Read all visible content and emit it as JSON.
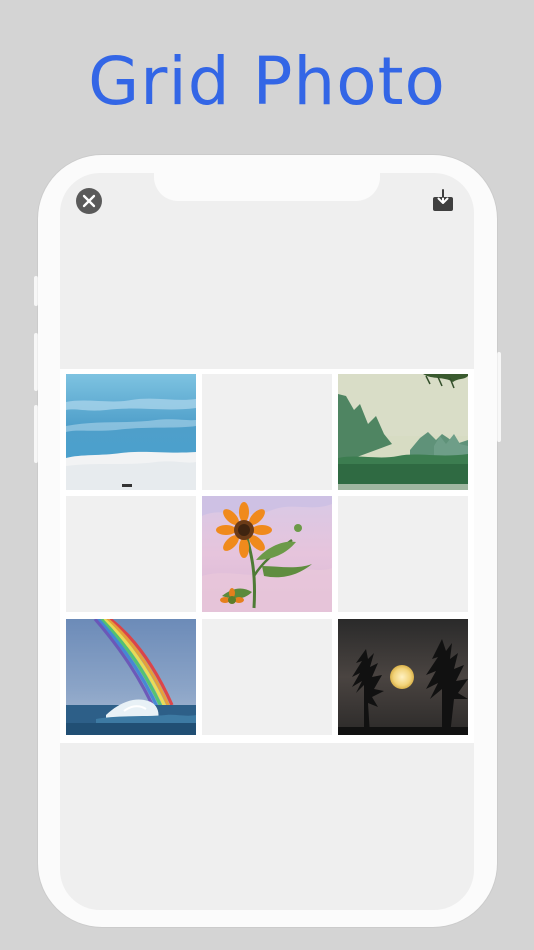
{
  "headline": "Grid Photo",
  "toolbar": {
    "close_icon": "close-icon",
    "download_icon": "download-icon"
  },
  "grid": {
    "columns": 3,
    "rows": 3,
    "tiles": [
      {
        "content": "sky-sea-clouds-photo"
      },
      {
        "content": "empty"
      },
      {
        "content": "green-mountains-river-photo"
      },
      {
        "content": "empty"
      },
      {
        "content": "sunflower-photo"
      },
      {
        "content": "empty"
      },
      {
        "content": "rainbow-wave-photo"
      },
      {
        "content": "empty"
      },
      {
        "content": "full-moon-trees-photo"
      }
    ]
  },
  "colors": {
    "headline": "#3366e6",
    "background": "#d4d4d4",
    "phone_frame": "#fbfbfb",
    "screen": "#efefef",
    "empty_tile": "#f0f0f0"
  }
}
